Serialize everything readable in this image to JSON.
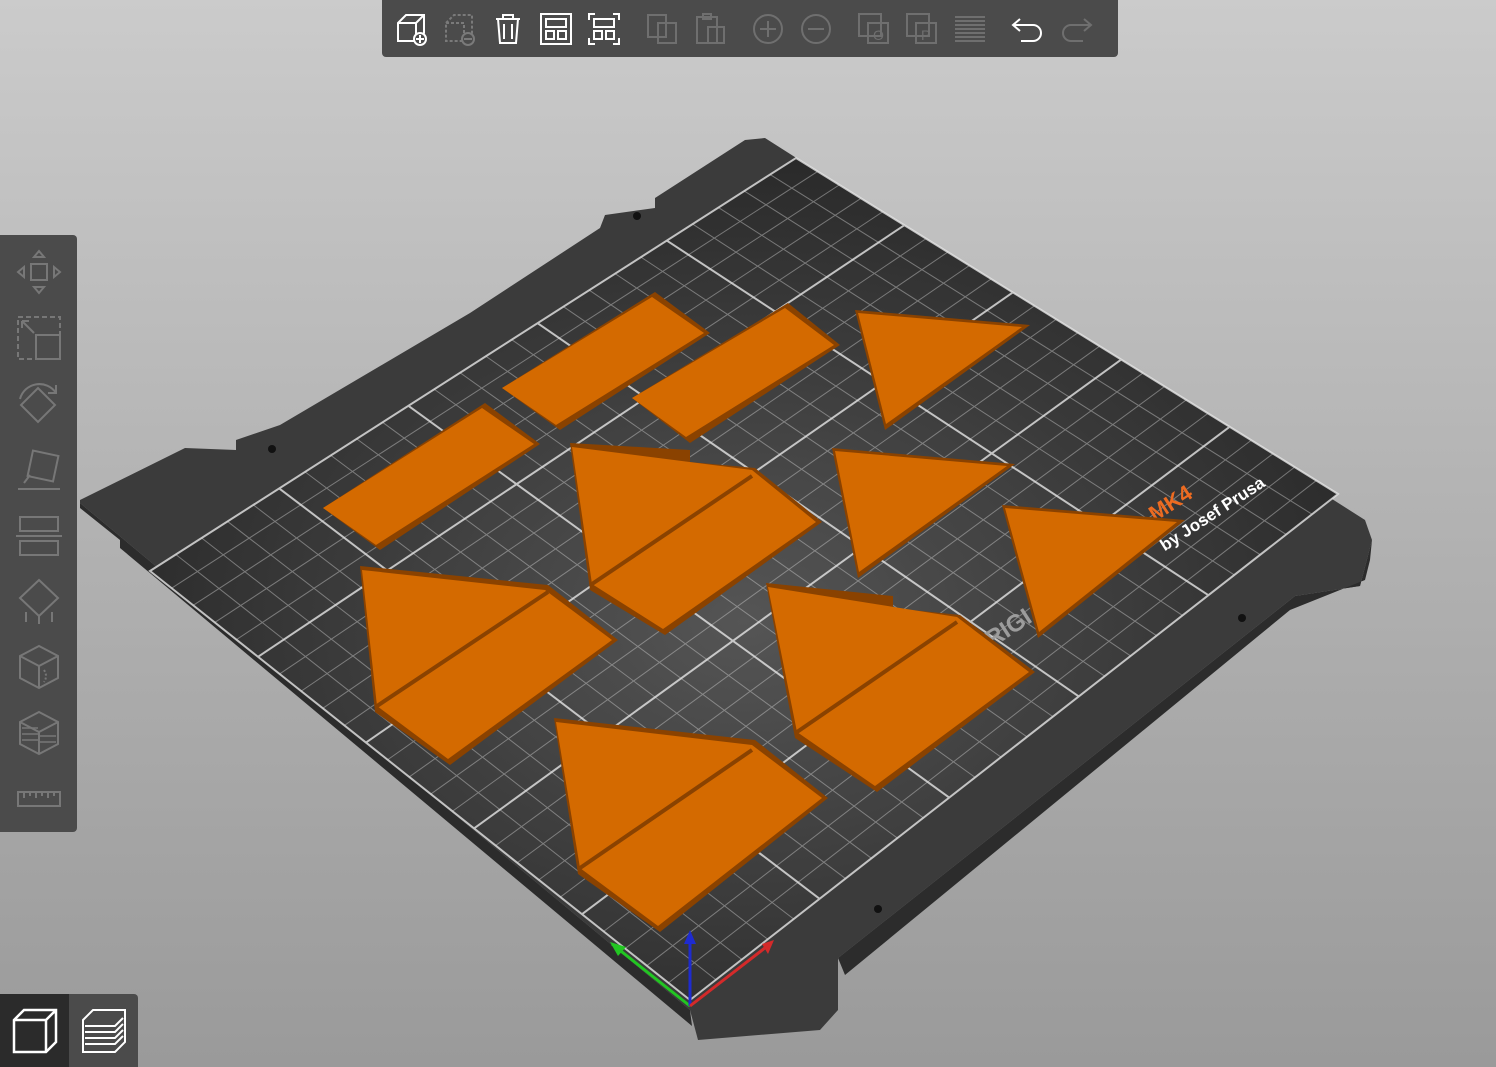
{
  "app": "PrusaSlicer 3D view",
  "top_toolbar": {
    "buttons": [
      {
        "name": "add-object",
        "icon": "add-object-icon",
        "enabled": true
      },
      {
        "name": "delete-object",
        "icon": "delete-object-icon",
        "enabled": false
      },
      {
        "name": "delete-all",
        "icon": "trash-icon",
        "enabled": true
      },
      {
        "name": "arrange",
        "icon": "arrange-icon",
        "enabled": true
      },
      {
        "name": "arrange-selection",
        "icon": "arrange-selection-icon",
        "enabled": true
      },
      {
        "name": "copy",
        "icon": "copy-icon",
        "enabled": false
      },
      {
        "name": "paste",
        "icon": "paste-icon",
        "enabled": false
      },
      {
        "name": "add-instance",
        "icon": "plus-circle-icon",
        "enabled": false
      },
      {
        "name": "remove-instance",
        "icon": "minus-circle-icon",
        "enabled": false
      },
      {
        "name": "split-to-objects",
        "icon": "split-objects-icon",
        "enabled": false
      },
      {
        "name": "split-to-parts",
        "icon": "split-parts-icon",
        "enabled": false
      },
      {
        "name": "layer-editing",
        "icon": "layers-icon",
        "enabled": false
      },
      {
        "name": "undo",
        "icon": "undo-icon",
        "enabled": true
      },
      {
        "name": "redo",
        "icon": "redo-icon",
        "enabled": false
      }
    ]
  },
  "left_toolbar": {
    "tools": [
      {
        "name": "move",
        "icon": "move-icon"
      },
      {
        "name": "scale",
        "icon": "scale-icon"
      },
      {
        "name": "rotate",
        "icon": "rotate-icon"
      },
      {
        "name": "place-on-face",
        "icon": "place-on-face-icon"
      },
      {
        "name": "cut",
        "icon": "cut-icon"
      },
      {
        "name": "supports",
        "icon": "support-painting-icon"
      },
      {
        "name": "seam",
        "icon": "seam-painting-icon"
      },
      {
        "name": "mmu",
        "icon": "mmu-painting-icon"
      },
      {
        "name": "measure",
        "icon": "ruler-icon"
      }
    ]
  },
  "view_switch": {
    "active": "3d",
    "buttons": [
      {
        "name": "view-3d",
        "icon": "cube-icon"
      },
      {
        "name": "view-preview",
        "icon": "layers-stack-icon"
      }
    ]
  },
  "bed": {
    "brand_text": "MK4",
    "maker_text": "by Josef Prusa",
    "logo_fragment": "RIGI"
  },
  "colors": {
    "object": "#d46a00",
    "object_edge": "#8a4200",
    "bed_frame": "#3a3a3a",
    "bed_surface": "#2f2f2f",
    "grid_line": "#cfcfcf",
    "brand_orange": "#ed6b21",
    "toolbar_bg": "#4b4b4b"
  }
}
